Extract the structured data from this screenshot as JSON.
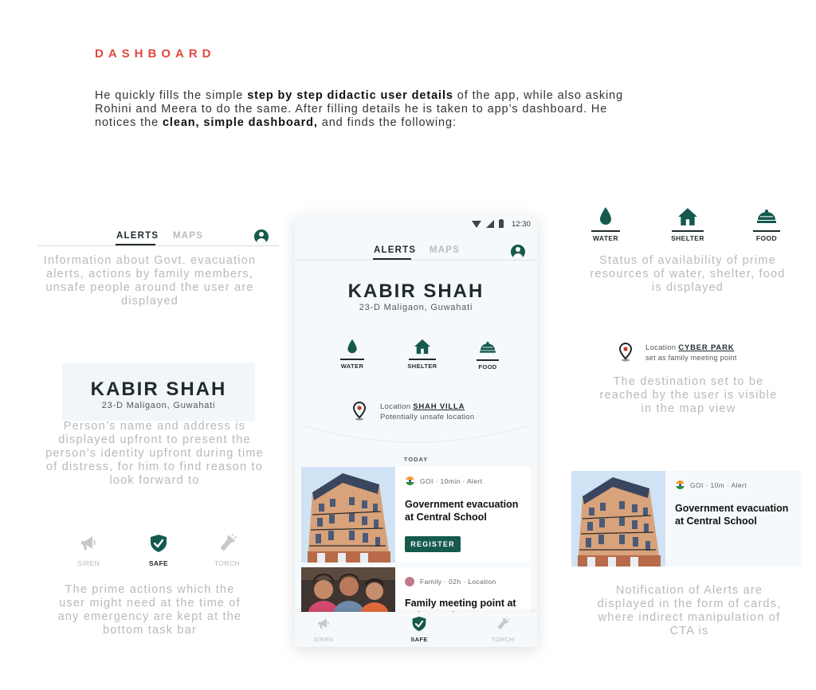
{
  "heading": "DASHBOARD",
  "intro": {
    "p1": "He quickly fills the simple ",
    "b1": "step by step didactic user details",
    "p2": " of the app, while also asking Rohini and Meera to do the same.  After filling details he is taken to app’s dashboard. He notices the ",
    "b2": "clean, simple dashboard,",
    "p3": " and finds the following:"
  },
  "tabs": {
    "alerts": "ALERTS",
    "maps": "MAPS"
  },
  "captions": {
    "alerts": "Information about Govt. evacuation alerts, actions by family members, unsafe people around the user are displayed",
    "name": "Person’s name and address is displayed upfront to present the person’s identity upfront during time of distress, for him to find reason to look forward to",
    "actions": "The prime actions which the user might need at the time of any emergency are kept at the bottom task bar",
    "resources": "Status of availability of prime resources of water, shelter, food is displayed",
    "destination": "The destination set to be reached by the user is visible in the map view",
    "notification": "Notification of Alerts are displayed in the form of cards, where indirect manipulation of CTA is"
  },
  "user": {
    "name": "KABIR SHAH",
    "address": "23-D Maligaon, Guwahati"
  },
  "resources": {
    "water": "WATER",
    "shelter": "SHELTER",
    "food": "FOOD"
  },
  "actions": {
    "siren": "SIREN",
    "safe": "SAFE",
    "torch": "TORCH"
  },
  "status": {
    "time": "12:30"
  },
  "location_unsafe": {
    "prefix": "Location",
    "name": "SHAH VILLA",
    "sub": "Potentially unsafe location"
  },
  "location_meeting": {
    "prefix": "Location",
    "name": "CYBER PARK",
    "sub": "set as family meeting point"
  },
  "today": "TODAY",
  "alert_card": {
    "meta": "GOI · 10min · Alert",
    "title": "Government evacuation at Central School",
    "cta": "REGISTER"
  },
  "family_card": {
    "meta": "Family · 02h · Location",
    "title": "Family meeting point at Cyber Park"
  },
  "sample_card": {
    "meta": "GOI · 10m · Alert",
    "title": "Government evacuation at Central School"
  },
  "colors": {
    "accent": "#155a4c",
    "heading": "#e2483d",
    "caption": "#b9b9b9"
  }
}
